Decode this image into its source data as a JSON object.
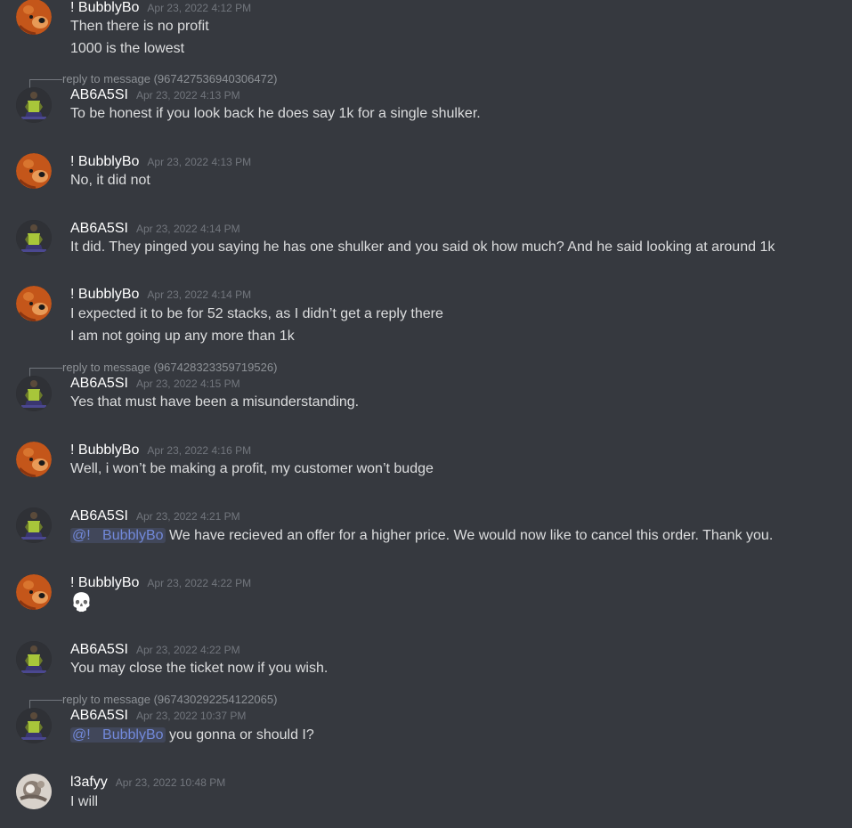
{
  "users": {
    "bubbly": "! BubblyBo",
    "ab": "AB6A5SI",
    "l3": "l3afyy"
  },
  "messages": [
    {
      "author": "! BubblyBo",
      "timestamp": "Apr 23, 2022 4:12 PM",
      "lines": [
        "Then there is no profit",
        "1000 is the lowest"
      ]
    },
    {
      "reply": "reply to message (967427536940306472)",
      "author": "AB6A5SI",
      "timestamp": "Apr 23, 2022 4:13 PM",
      "lines": [
        "To be honest if you look back he does say 1k for a single shulker."
      ]
    },
    {
      "author": "! BubblyBo",
      "timestamp": "Apr 23, 2022 4:13 PM",
      "lines": [
        "No, it did not"
      ]
    },
    {
      "author": "AB6A5SI",
      "timestamp": "Apr 23, 2022 4:14 PM",
      "lines": [
        "It did. They pinged you saying he has one shulker and you said ok how much? And he said looking at around 1k"
      ]
    },
    {
      "author": "! BubblyBo",
      "timestamp": "Apr 23, 2022 4:14 PM",
      "lines": [
        "I expected it to be for 52 stacks, as I didn’t get a reply there",
        "I am not going up any more than 1k"
      ]
    },
    {
      "reply": "reply to message (967428323359719526)",
      "author": "AB6A5SI",
      "timestamp": "Apr 23, 2022 4:15 PM",
      "lines": [
        "Yes that must have been a misunderstanding."
      ]
    },
    {
      "author": "! BubblyBo",
      "timestamp": "Apr 23, 2022 4:16 PM",
      "lines": [
        "Well, i won’t be making a profit, my customer won’t budge"
      ]
    },
    {
      "author": "AB6A5SI",
      "timestamp": "Apr 23, 2022 4:21 PM",
      "mention": "@!   BubblyBo",
      "lines": [
        "We have recieved an offer for a higher price. We would now like to cancel this order. Thank you."
      ]
    },
    {
      "author": "! BubblyBo",
      "timestamp": "Apr 23, 2022 4:22 PM",
      "emoji": "💀",
      "emoji_name": "skull"
    },
    {
      "author": "AB6A5SI",
      "timestamp": "Apr 23, 2022 4:22 PM",
      "lines": [
        "You may close the ticket now if you wish."
      ]
    },
    {
      "reply": "reply to message (967430292254122065)",
      "author": "AB6A5SI",
      "timestamp": "Apr 23, 2022 10:37 PM",
      "mention": "@!   BubblyBo",
      "lines": [
        "you gonna or should I?"
      ]
    },
    {
      "author": "l3afyy",
      "timestamp": "Apr 23, 2022 10:48 PM",
      "lines": [
        "I will"
      ]
    }
  ],
  "colors": {
    "background": "#36393f",
    "author": "#ffffff",
    "text": "#dcddde",
    "timestamp": "#72767d",
    "mention": "#7289da"
  }
}
